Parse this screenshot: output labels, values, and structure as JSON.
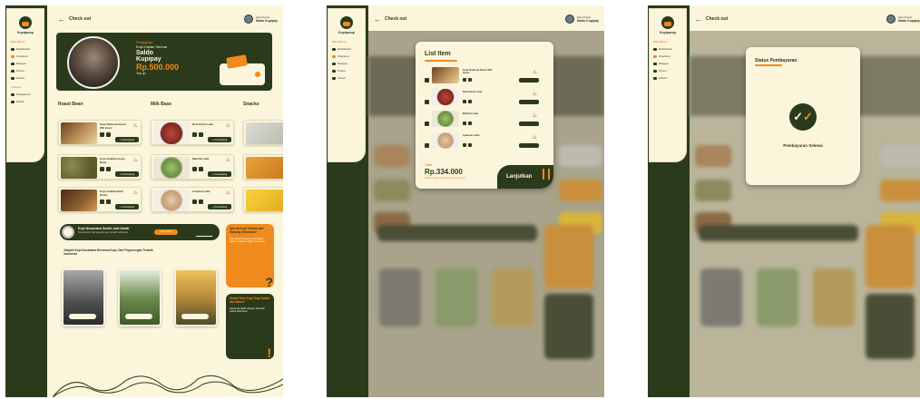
{
  "header": {
    "page_title": "Check out",
    "back_icon": "arrow-left-icon",
    "profile_name": "Akun Kamu",
    "profile_sub": "Saldo Kupipay"
  },
  "sidebar": {
    "brand": "Kupipacup",
    "section_main": "Main Menu",
    "items": [
      "Dashboard",
      "Checkout",
      "Riwayat",
      "Promo",
      "Favorit"
    ],
    "section_other": "Lainnya",
    "others": [
      "Pengaturan",
      "Keluar"
    ]
  },
  "banner": {
    "greet": "Pengguna",
    "subtitle": "Kopi Kalian Semua",
    "label_1": "Saldo",
    "label_2": "Kupipay",
    "amount": "Rp.500.000",
    "topup": "Top up"
  },
  "categories": {
    "roast_bean": "Roast Bean",
    "milk_base": "Milk Base",
    "snacks": "Snacks"
  },
  "products": {
    "roast": [
      {
        "name": "Kopi Robusta Roast 250 Gram"
      },
      {
        "name": "Kopi Arabika Green Bean"
      },
      {
        "name": "Kopi Arabika Dark Roast"
      }
    ],
    "milk": [
      {
        "name": "Red Velvet Latte"
      },
      {
        "name": "Matcha Latte"
      },
      {
        "name": "Caramel Latte"
      }
    ],
    "add_label": "+ Keranjang"
  },
  "promo": {
    "title": "Kopi Nusantara Sudah Jadi Akrab",
    "subtitle": "Nikmati kopi dari pegunungan terbaik Indonesia",
    "button": "Lihat Detail"
  },
  "info_orange": {
    "title": "Apa itu Kupi Terbaik dari Gunung Indonesia?",
    "body": "Kopi dipetik langsung dari kebun petani di dataran tinggi nusantara."
  },
  "info_green": {
    "title": "Sudah Tahu Kopi Kupi Kalian dari Mana?",
    "body": "Setiap biji dipilih dengan teliti oleh petani lokal kami."
  },
  "stories_heading": "Jelajahi Kopi Nusantara Bersama Kupi, Dari Pegunungan Terbaik Indonesia",
  "checkout": {
    "title": "List Item",
    "items": [
      {
        "name": "Kopi Robusta Roast 250 Gram"
      },
      {
        "name": "Red Velvet Latte"
      },
      {
        "name": "Matcha Latte"
      },
      {
        "name": "Caramel Latte"
      }
    ],
    "total_label": "Total",
    "total_value": "Rp.334.000",
    "note": "Saldo kupipay akan terpotong otomatis",
    "continue": "Lanjutkan"
  },
  "payment_status": {
    "title": "Status Pembayaran",
    "message": "Pembayaran Selesai"
  },
  "colors": {
    "dark_green": "#2c3a1c",
    "cream": "#fbf5dc",
    "orange": "#f08a1c"
  }
}
